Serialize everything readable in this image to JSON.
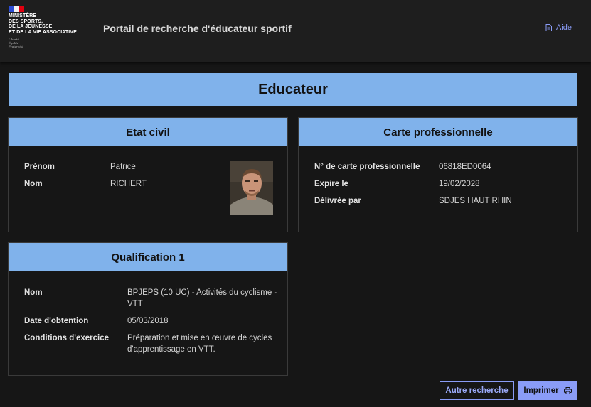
{
  "header": {
    "ministry_lines": [
      "MINISTÈRE",
      "DES SPORTS,",
      "DE LA JEUNESSE",
      "ET DE LA VIE ASSOCIATIVE"
    ],
    "motto_lines": [
      "Liberté",
      "Égalité",
      "Fraternité"
    ],
    "portal_title": "Portail de recherche d'éducateur sportif",
    "help_label": "Aide",
    "help_icon": "document-icon"
  },
  "page": {
    "title": "Educateur"
  },
  "etat_civil": {
    "title": "Etat civil",
    "fields": [
      {
        "label": "Prénom",
        "value": "Patrice"
      },
      {
        "label": "Nom",
        "value": "RICHERT"
      }
    ]
  },
  "carte_pro": {
    "title": "Carte professionnelle",
    "fields": [
      {
        "label": "N° de carte professionnelle",
        "value": "06818ED0064"
      },
      {
        "label": "Expire le",
        "value": "19/02/2028"
      },
      {
        "label": "Délivrée par",
        "value": "SDJES HAUT RHIN"
      }
    ]
  },
  "qualification": {
    "title": "Qualification 1",
    "fields": [
      {
        "label": "Nom",
        "value_lines": [
          "BPJEPS (10 UC) - Activités du cyclisme -",
          "VTT"
        ]
      },
      {
        "label": "Date d'obtention",
        "value_lines": [
          "05/03/2018"
        ]
      },
      {
        "label": "Conditions d'exercice",
        "value_lines": [
          "Préparation et mise en œuvre de cycles",
          "d'apprentissage en VTT."
        ]
      }
    ]
  },
  "actions": {
    "other_search_label": "Autre recherche",
    "print_label": "Imprimer",
    "print_icon": "printer-icon"
  },
  "colors": {
    "accent": "#8a9cf7",
    "section_header": "#80b2eb",
    "background": "#161616"
  }
}
